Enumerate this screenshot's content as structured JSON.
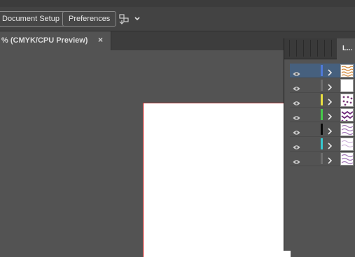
{
  "control_bar": {
    "document_setup_label": "Document Setup",
    "preferences_label": "Preferences",
    "arrange_icon": "arrange-documents-icon"
  },
  "document_tab": {
    "title": "% (CMYK/CPU Preview)",
    "close_glyph": "×"
  },
  "layers_panel": {
    "tab_label": "L...",
    "layers": [
      {
        "color": "#4f79d8",
        "selected": true,
        "thumb": "pattern-orange"
      },
      {
        "color": "#6d6d6d",
        "selected": false,
        "thumb": "blank"
      },
      {
        "color": "#e8df41",
        "selected": false,
        "thumb": "pattern-dots"
      },
      {
        "color": "#46c94a",
        "selected": false,
        "thumb": "pattern-purple"
      },
      {
        "color": "#0a0a0a",
        "selected": false,
        "thumb": "pattern-lavender"
      },
      {
        "color": "#36c8cf",
        "selected": false,
        "thumb": "pattern-lavender-light"
      },
      {
        "color": "#6d6d6d",
        "selected": false,
        "thumb": "pattern-lavender"
      }
    ]
  },
  "colors": {
    "artboard_edge": "#c81e1e",
    "selection": "#46607e"
  }
}
